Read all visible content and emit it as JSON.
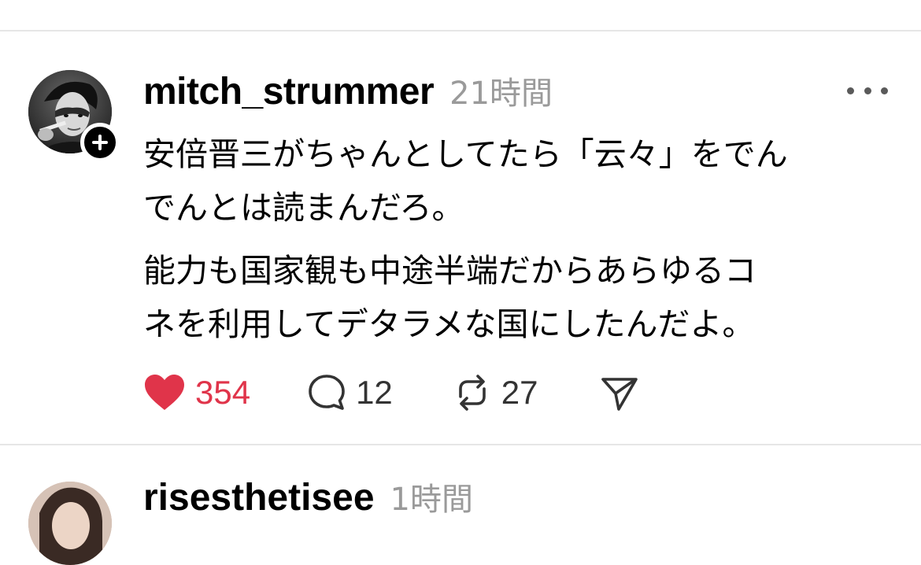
{
  "post": {
    "username": "mitch_strummer",
    "timestamp": "21時間",
    "paragraphs": [
      "安倍晋三がちゃんとしてたら「云々」をでん\nでんとは読まんだろ。",
      "能力も国家観も中途半端だからあらゆるコ\nネを利用してデタラメな国にしたんだよ。"
    ],
    "actions": {
      "likes": "354",
      "replies": "12",
      "reposts": "27"
    },
    "liked": true,
    "icons": {
      "like": "heart-icon",
      "reply": "comment-bubble-icon",
      "repost": "repost-icon",
      "share": "send-icon",
      "more": "more-horizontal-icon",
      "follow": "plus-icon"
    },
    "colors": {
      "like_red": "#e0344a",
      "muted_gray": "#9a9a9a"
    }
  },
  "next_post": {
    "username": "risesthetisee",
    "timestamp": "1時間"
  }
}
